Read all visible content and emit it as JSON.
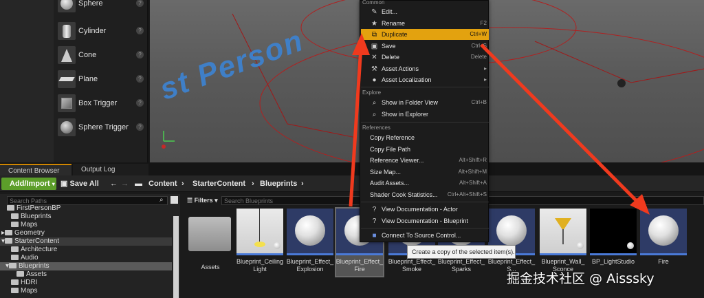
{
  "place_actors": {
    "items": [
      {
        "label": "Sphere",
        "icon": "sphere-icon"
      },
      {
        "label": "Cylinder",
        "icon": "cylinder-icon"
      },
      {
        "label": "Cone",
        "icon": "cone-icon"
      },
      {
        "label": "Plane",
        "icon": "plane-icon"
      },
      {
        "label": "Box Trigger",
        "icon": "box-trigger-icon"
      },
      {
        "label": "Sphere Trigger",
        "icon": "sphere-trigger-icon"
      }
    ]
  },
  "viewport": {
    "floor_text": "st Person"
  },
  "tabs": [
    {
      "label": "Content Browser",
      "active": true
    },
    {
      "label": "Output Log",
      "active": false
    }
  ],
  "toolbar": {
    "add_import": "Add/Import",
    "save_all": "Save All",
    "breadcrumb": [
      "Content",
      "StarterContent",
      "Blueprints"
    ]
  },
  "tree": {
    "search_placeholder": "Search Paths",
    "rows": [
      "FirstPersonBP",
      "Blueprints",
      "Maps",
      "Geometry",
      "StarterContent",
      "Architecture",
      "Audio",
      "Blueprints",
      "Assets",
      "HDRI",
      "Maps"
    ]
  },
  "assets_panel": {
    "filters_label": "Filters",
    "search_placeholder": "Search Blueprints",
    "tiles": [
      {
        "label": "Assets",
        "kind": "folder"
      },
      {
        "label": "Blueprint_Ceiling Light",
        "kind": "light"
      },
      {
        "label": "Blueprint_Effect_ Explosion",
        "kind": "sphere"
      },
      {
        "label": "Blueprint_Effect_ Fire",
        "kind": "sphere",
        "selected": true
      },
      {
        "label": "Blueprint_Effect_ Smoke",
        "kind": "sphere"
      },
      {
        "label": "Blueprint_Effect_ Sparks",
        "kind": "sphere"
      },
      {
        "label": "Blueprint_Effect_ S...",
        "kind": "sphere"
      },
      {
        "label": "Blueprint_Wall_ Sconce",
        "kind": "sconce"
      },
      {
        "label": "BP_LightStudio",
        "kind": "dark"
      },
      {
        "label": "Fire",
        "kind": "sphere"
      }
    ]
  },
  "context_menu": {
    "sections": [
      {
        "title": "Common",
        "items": [
          {
            "label": "Edit...",
            "shortcut": "",
            "icon": "pencil-icon"
          },
          {
            "label": "Rename",
            "shortcut": "F2",
            "icon": "star-icon"
          },
          {
            "label": "Duplicate",
            "shortcut": "Ctrl+W",
            "icon": "duplicate-icon",
            "highlighted": true
          },
          {
            "label": "Save",
            "shortcut": "Ctrl+S",
            "icon": "save-icon"
          },
          {
            "label": "Delete",
            "shortcut": "Delete",
            "icon": "close-icon"
          },
          {
            "label": "Asset Actions",
            "shortcut": "",
            "icon": "wrench-icon",
            "submenu": true
          },
          {
            "label": "Asset Localization",
            "shortcut": "",
            "icon": "globe-icon",
            "submenu": true
          }
        ]
      },
      {
        "title": "Explore",
        "items": [
          {
            "label": "Show in Folder View",
            "shortcut": "Ctrl+B",
            "icon": "search-icon"
          },
          {
            "label": "Show in Explorer",
            "shortcut": "",
            "icon": "search-icon"
          }
        ]
      },
      {
        "title": "References",
        "items": [
          {
            "label": "Copy Reference",
            "shortcut": "",
            "icon": ""
          },
          {
            "label": "Copy File Path",
            "shortcut": "",
            "icon": ""
          },
          {
            "label": "Reference Viewer...",
            "shortcut": "Alt+Shift+R",
            "icon": ""
          },
          {
            "label": "Size Map...",
            "shortcut": "Alt+Shift+M",
            "icon": ""
          },
          {
            "label": "Audit Assets...",
            "shortcut": "Alt+Shift+A",
            "icon": ""
          },
          {
            "label": "Shader Cook Statistics...",
            "shortcut": "Ctrl+Alt+Shift+S",
            "icon": ""
          }
        ]
      },
      {
        "title": "",
        "items": [
          {
            "label": "View Documentation - Actor",
            "shortcut": "",
            "icon": "help-icon"
          },
          {
            "label": "View Documentation - Blueprint",
            "shortcut": "",
            "icon": "help-icon"
          }
        ]
      },
      {
        "title": "",
        "items": [
          {
            "label": "Connect To Source Control...",
            "shortcut": "",
            "icon": "source-control-icon"
          }
        ]
      }
    ]
  },
  "tooltip": "Create a copy of the selected item(s).",
  "watermark": "掘金技术社区 @ Aisssky",
  "colors": {
    "accent": "#e3a20f",
    "add_button": "#5c9e2a",
    "arrow": "#f03a1e"
  }
}
